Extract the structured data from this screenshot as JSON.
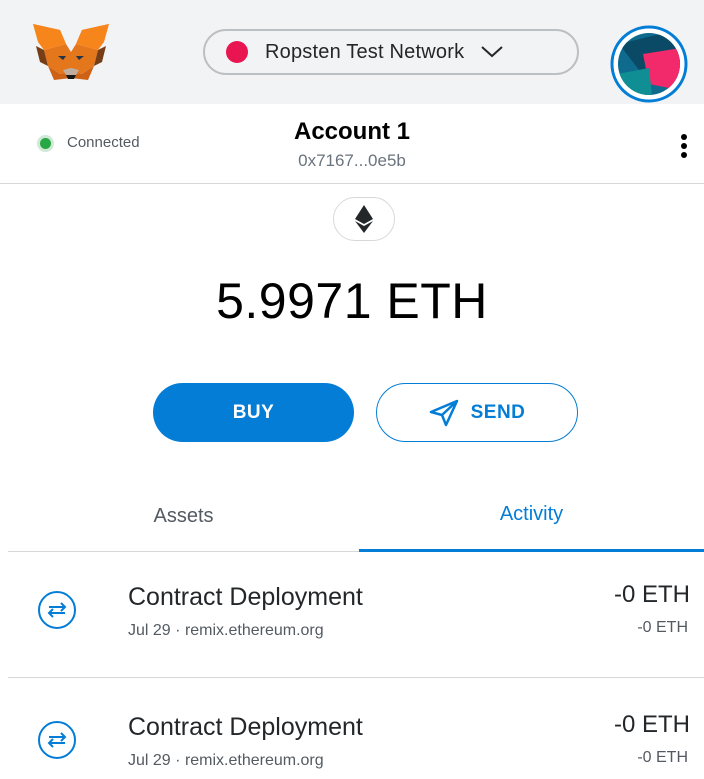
{
  "header": {
    "network_label": "Ropsten Test Network",
    "network_color": "#e91550"
  },
  "account": {
    "connection_status": "Connected",
    "name": "Account 1",
    "address": "0x7167...0e5b"
  },
  "balance": {
    "amount": "5.9971 ETH"
  },
  "actions": {
    "buy_label": "BUY",
    "send_label": "SEND"
  },
  "tabs": [
    {
      "label": "Assets",
      "active": false
    },
    {
      "label": "Activity",
      "active": true
    }
  ],
  "transactions": [
    {
      "title": "Contract Deployment",
      "date": "Jul 29",
      "origin": "remix.ethereum.org",
      "amount": "-0 ETH",
      "fiat": "-0 ETH"
    },
    {
      "title": "Contract Deployment",
      "date": "Jul 29",
      "origin": "remix.ethereum.org",
      "amount": "-0 ETH",
      "fiat": "-0 ETH"
    }
  ],
  "colors": {
    "accent": "#037dd6",
    "header_bg": "#f2f3f4",
    "connected": "#28a745"
  },
  "icons": {
    "logo": "metamask-fox-icon",
    "avatar": "account-avatar-icon",
    "network_menu": "chevron-down-icon",
    "eth": "ethereum-icon",
    "send": "send-arrow-icon",
    "tx": "contract-interaction-icon",
    "menu": "kebab-menu-icon"
  }
}
